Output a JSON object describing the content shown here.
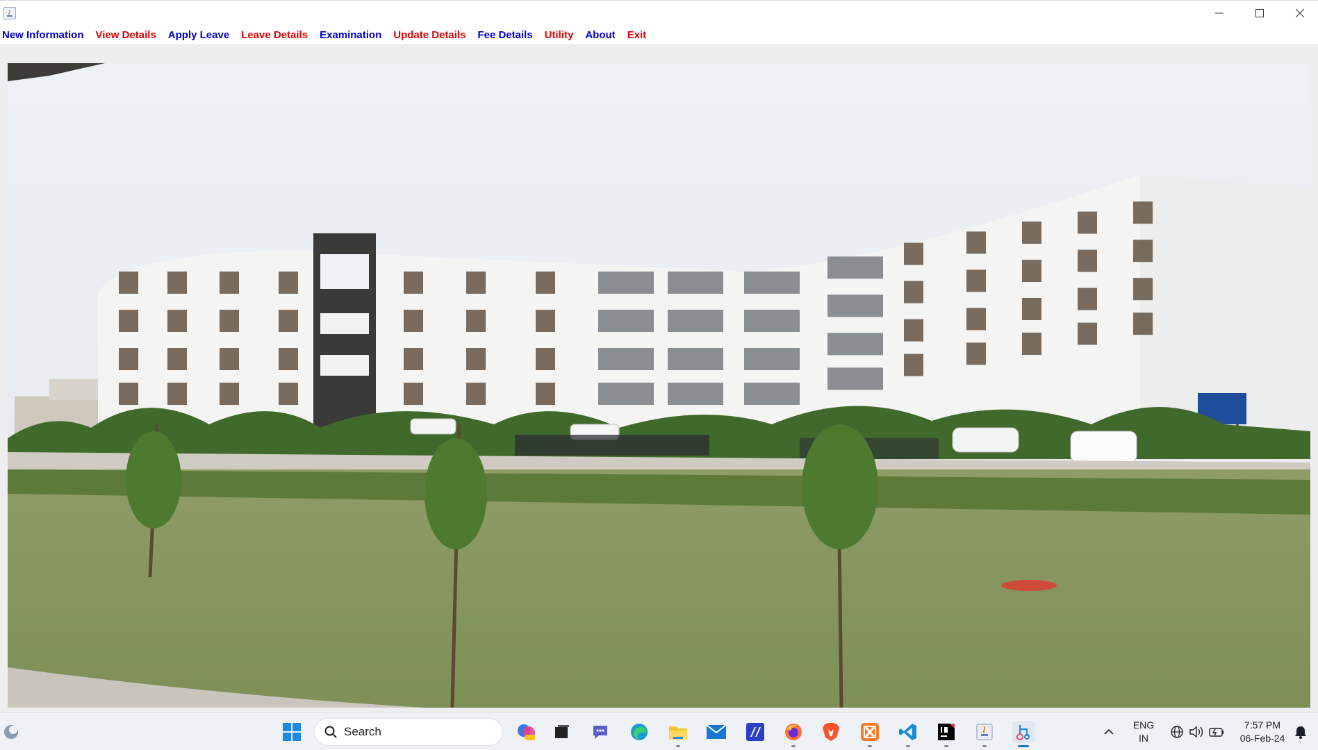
{
  "window": {
    "title": ""
  },
  "menu": {
    "items": [
      {
        "label": "New Information",
        "color": "#0000cc"
      },
      {
        "label": "View Details",
        "color": "#e00000"
      },
      {
        "label": "Apply Leave",
        "color": "#0000cc"
      },
      {
        "label": "Leave Details",
        "color": "#e00000"
      },
      {
        "label": "Examination",
        "color": "#0000cc"
      },
      {
        "label": "Update Details",
        "color": "#e00000"
      },
      {
        "label": "Fee Details",
        "color": "#0000cc"
      },
      {
        "label": "Utility",
        "color": "#e00000"
      },
      {
        "label": "About",
        "color": "#0000cc"
      },
      {
        "label": "Exit",
        "color": "#e00000"
      }
    ]
  },
  "photo": {
    "icon": "campus-building-photo"
  },
  "taskbar": {
    "search_placeholder": "Search",
    "tray": {
      "language": "ENG",
      "region": "IN",
      "time": "7:57 PM",
      "date": "06-Feb-24"
    }
  }
}
